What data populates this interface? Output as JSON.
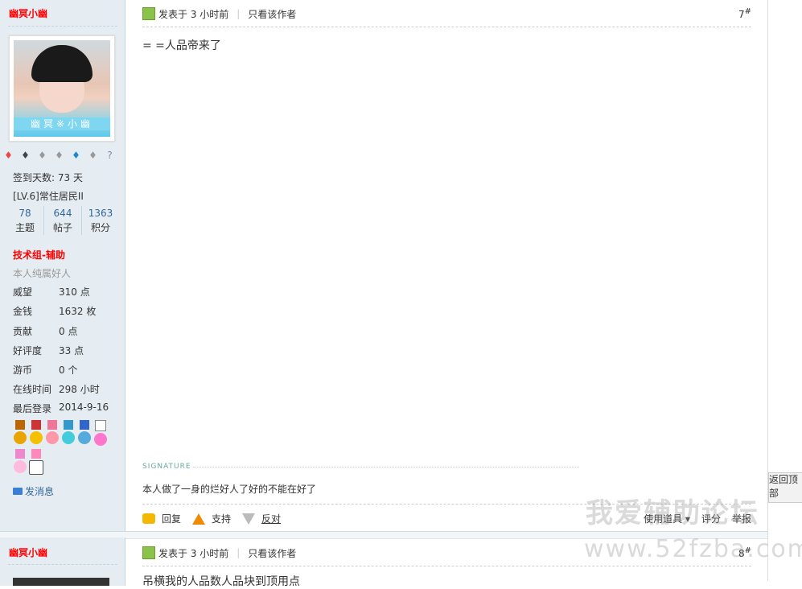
{
  "post1": {
    "author": "幽冥小幽",
    "avatar_caption": "幽冥※小幽",
    "signin_days": "签到天数: 73 天",
    "level": "[LV.6]常住居民II",
    "counts": [
      {
        "num": "78",
        "label": "主题"
      },
      {
        "num": "644",
        "label": "帖子"
      },
      {
        "num": "1363",
        "label": "积分"
      }
    ],
    "group": "技术组-辅助",
    "desc": "本人纯属好人",
    "stats": [
      {
        "k": "威望",
        "v": "310 点"
      },
      {
        "k": "金钱",
        "v": "1632 枚"
      },
      {
        "k": "贡献",
        "v": "0 点"
      },
      {
        "k": "好评度",
        "v": "33 点"
      },
      {
        "k": "游币",
        "v": "0 个"
      },
      {
        "k": "在线时间",
        "v": "298 小时"
      },
      {
        "k": "最后登录",
        "v": "2014-9-16"
      }
    ],
    "send_msg": "发消息",
    "posted": "发表于 3 小时前",
    "only_author": "只看该作者",
    "floor": "7",
    "floor_suffix": "#",
    "content": "= =人品帝来了",
    "sig_label": "SIGNATURE",
    "signature": "本人做了一身的烂好人了好的不能在好了",
    "reply": "回复",
    "support": "支持",
    "oppose": "反对",
    "use_tool": "使用道具",
    "rate": "评分",
    "report": "举报"
  },
  "post2": {
    "author": "幽冥小幽",
    "posted": "发表于 3 小时前",
    "only_author": "只看该作者",
    "floor": "8",
    "floor_suffix": "#",
    "content_partial": "吊横我的人品数人品块到顶用点"
  },
  "back_to_top": "返回顶部",
  "watermark_cn": "我爱辅助论坛",
  "watermark_url": "www.52fzba.com"
}
